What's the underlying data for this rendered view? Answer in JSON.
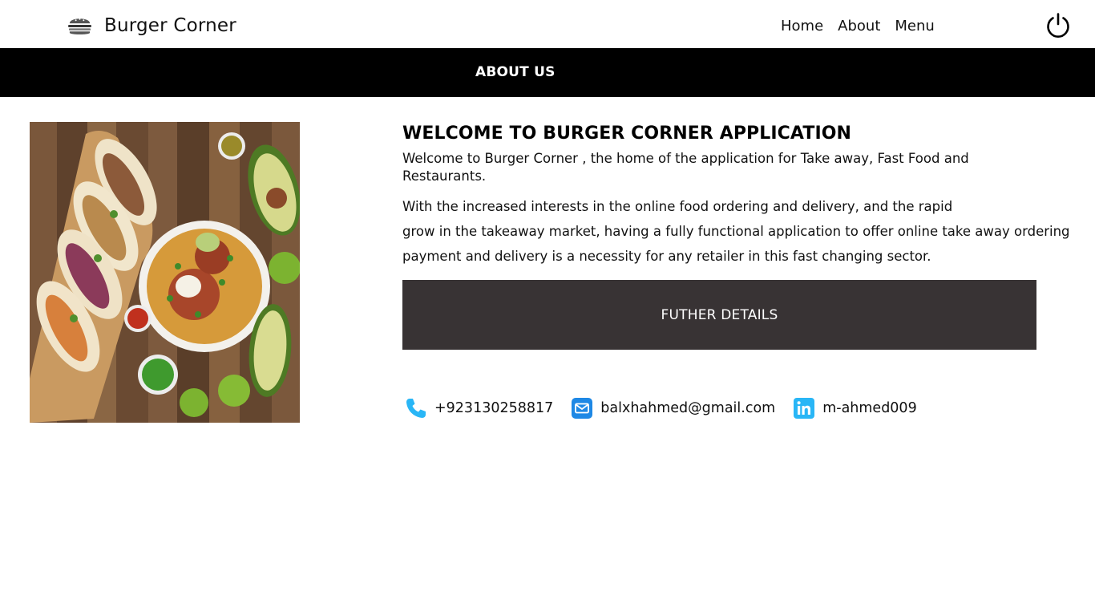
{
  "header": {
    "brand_name": "Burger Corner",
    "logo_icon": "burger-icon",
    "nav": [
      {
        "label": "Home"
      },
      {
        "label": "About"
      },
      {
        "label": "Menu"
      }
    ],
    "power_icon": "power-icon"
  },
  "banner": {
    "title": "ABOUT US"
  },
  "image": {
    "subject": "food-platter-image"
  },
  "about": {
    "heading": "WELCOME TO BURGER CORNER APPLICATION",
    "intro": "Welcome to Burger Corner , the home of the application for Take away, Fast Food and Restaurants.",
    "body_lines": [
      "With the increased interests in the online food ordering and delivery, and the rapid",
      "grow in the takeaway market, having a fully functional application to offer online take away ordering",
      "payment and delivery is a necessity for any retailer in this fast changing sector."
    ],
    "button_label": "FUTHER DETAILS"
  },
  "contacts": [
    {
      "icon": "phone-icon",
      "text": "+923130258817"
    },
    {
      "icon": "email-icon",
      "text": "balxhahmed@gmail.com"
    },
    {
      "icon": "linkedin-icon",
      "text": "m-ahmed009"
    }
  ],
  "colors": {
    "banner_bg": "#000000",
    "button_bg": "#383334",
    "contact_icon": "#29b6f6"
  }
}
